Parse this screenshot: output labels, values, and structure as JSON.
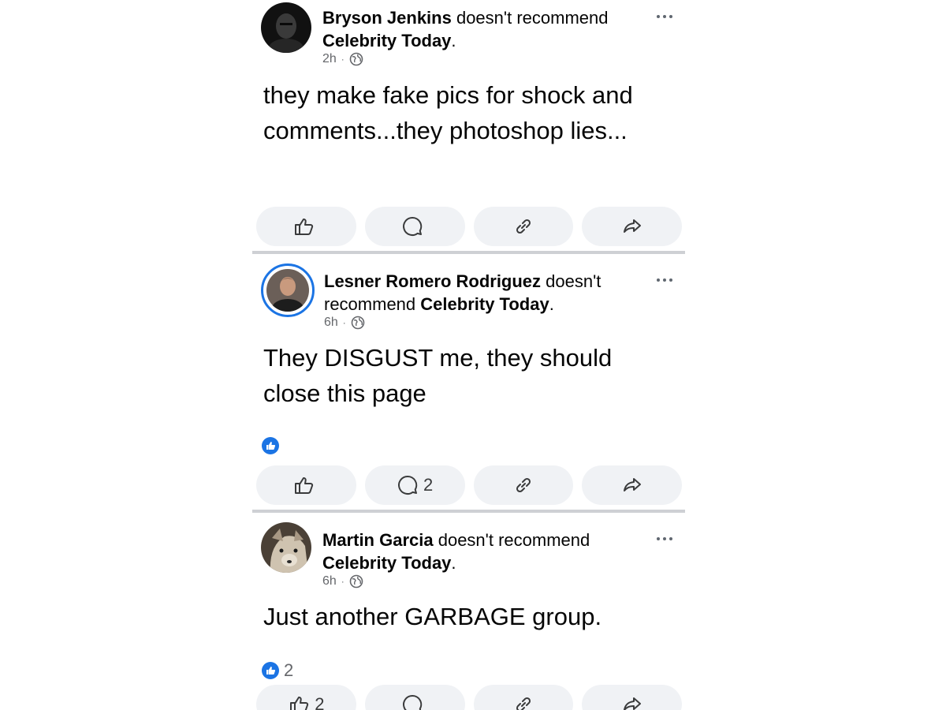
{
  "posts": [
    {
      "author": "Bryson Jenkins",
      "verb": " doesn't recommend ",
      "page": "Celebrity Today",
      "period": ".",
      "time": "2h",
      "separator": "·",
      "text": "they make fake pics for shock and comments...they photoshop lies...",
      "reaction_count": "",
      "comment_count": "",
      "like_count": ""
    },
    {
      "author": "Lesner Romero Rodriguez",
      "verb": " doesn't recommend ",
      "page": "Celebrity Today",
      "period": ".",
      "time": "6h",
      "separator": "·",
      "text": "They DISGUST me, they should close this page",
      "reaction_count": "",
      "comment_count": "2",
      "like_count": ""
    },
    {
      "author": "Martin Garcia",
      "verb": " doesn't recommend ",
      "page": "Celebrity Today",
      "period": ".",
      "time": "6h",
      "separator": "·",
      "text": "Just another GARBAGE group.",
      "reaction_count": "2",
      "comment_count": "",
      "like_count": "2"
    }
  ],
  "icons": {
    "like": "thumbs-up-outline-icon",
    "comment": "speech-bubble-icon",
    "copy_link": "link-icon",
    "share": "share-arrow-icon",
    "audience": "globe-icon",
    "reaction": "blue-like-badge-icon",
    "more": "more-options-icon"
  },
  "colors": {
    "brand_blue": "#1b74e4",
    "action_bg": "#f0f2f5",
    "meta_gray": "#65676b",
    "divider": "#ced0d4"
  }
}
